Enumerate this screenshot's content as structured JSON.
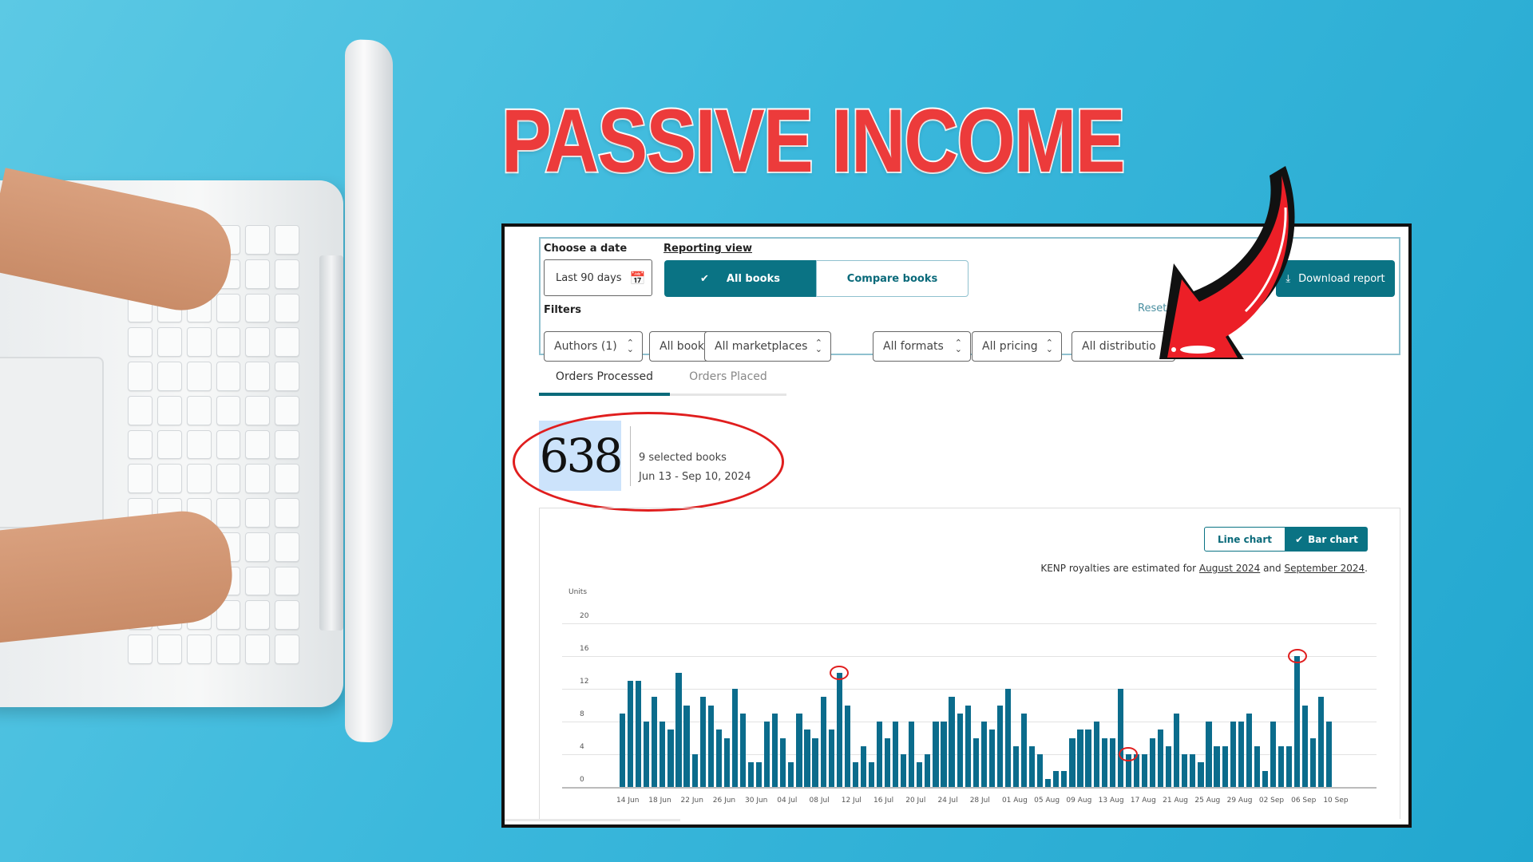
{
  "headline": "PASSIVE INCOME",
  "colors": {
    "accent_teal": "#0a7384",
    "headline_red": "#ec3b3b",
    "bar": "#0b6c8c",
    "annotation_red": "#e01e1e",
    "background": "#3bb8dc"
  },
  "filters": {
    "choose_date_label": "Choose a date",
    "date_value": "Last 90 days",
    "date_icon": "calendar-icon",
    "reporting_view_label": "Reporting view",
    "view_options": [
      {
        "label": "All books",
        "selected": true
      },
      {
        "label": "Compare books",
        "selected": false
      }
    ],
    "download_label": "Download report",
    "download_icon": "download-icon",
    "filters_label": "Filters",
    "reset_label": "Reset",
    "selects": [
      "Authors (1)",
      "All books",
      "All marketplaces",
      "All formats",
      "All pricing",
      "All distributio"
    ]
  },
  "tabs": [
    {
      "label": "Orders Processed",
      "active": true
    },
    {
      "label": "Orders Placed",
      "active": false
    }
  ],
  "summary": {
    "total": "638",
    "books": "9 selected books",
    "range": "Jun 13 - Sep 10, 2024"
  },
  "chart_toggle": [
    {
      "label": "Line chart",
      "selected": false
    },
    {
      "label": "Bar chart",
      "selected": true
    }
  ],
  "kenp_note": {
    "prefix": "KENP royalties are estimated for ",
    "link1": "August 2024",
    "mid": " and ",
    "link2": "September 2024",
    "suffix": "."
  },
  "chart_data": {
    "type": "bar",
    "ylabel": "Units",
    "ylim": [
      0,
      20
    ],
    "yticks": [
      "0",
      "4",
      "8",
      "12",
      "16",
      "20"
    ],
    "grid": true,
    "xtick_labels": [
      "14 Jun",
      "18 Jun",
      "22 Jun",
      "26 Jun",
      "30 Jun",
      "04 Jul",
      "08 Jul",
      "12 Jul",
      "16 Jul",
      "20 Jul",
      "24 Jul",
      "28 Jul",
      "01 Aug",
      "05 Aug",
      "09 Aug",
      "13 Aug",
      "17 Aug",
      "21 Aug",
      "25 Aug",
      "29 Aug",
      "02 Sep",
      "06 Sep",
      "10 Sep"
    ],
    "values": [
      9,
      13,
      13,
      8,
      11,
      8,
      7,
      14,
      10,
      4,
      11,
      10,
      7,
      6,
      12,
      9,
      3,
      3,
      8,
      9,
      6,
      3,
      9,
      7,
      6,
      11,
      7,
      14,
      10,
      3,
      5,
      3,
      8,
      6,
      8,
      4,
      8,
      3,
      4,
      8,
      8,
      11,
      9,
      10,
      6,
      8,
      7,
      10,
      12,
      5,
      9,
      5,
      4,
      1,
      2,
      2,
      6,
      7,
      7,
      8,
      6,
      6,
      12,
      4,
      4,
      4,
      6,
      7,
      5,
      9,
      4,
      4,
      3,
      8,
      5,
      5,
      8,
      8,
      9,
      5,
      2,
      8,
      5,
      5,
      16,
      10,
      6,
      11,
      8
    ],
    "highlighted_dates": [
      "10 Jul",
      "15 Aug",
      "05 Sep"
    ]
  }
}
